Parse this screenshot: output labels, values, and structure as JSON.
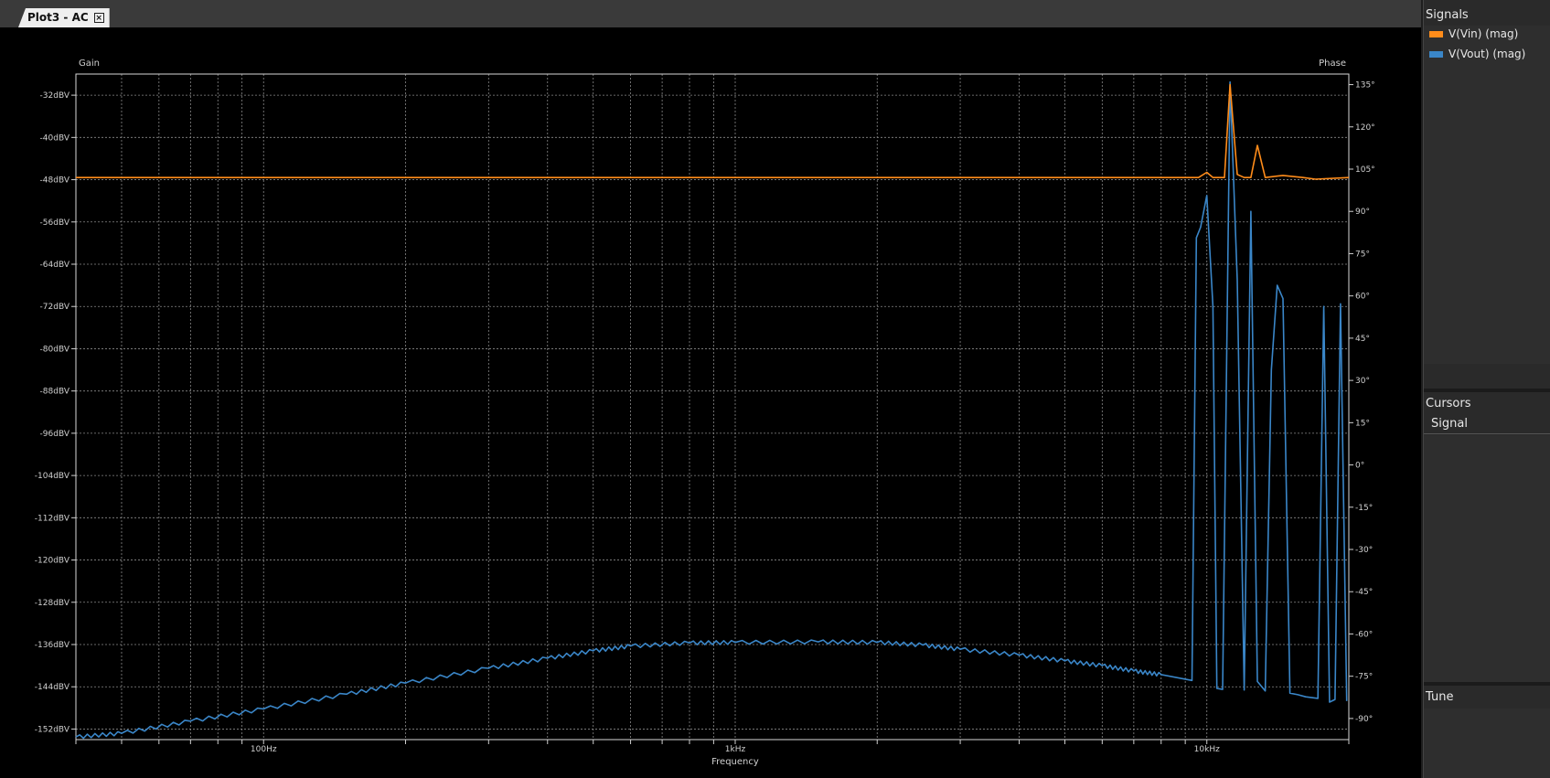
{
  "tab": {
    "label": "Plot3 - AC",
    "close_glyph": "×"
  },
  "panels": {
    "signals_title": "Signals",
    "cursors_title": "Cursors",
    "cursors_column": "Signal",
    "tune_title": "Tune"
  },
  "colors": {
    "vin": "#ff8c1a",
    "vout": "#3a86c8",
    "grid": "#8a8a8a",
    "bg": "#000000"
  },
  "chart_data": {
    "type": "line",
    "x_scale": "log",
    "xlim": [
      40,
      20000
    ],
    "ylim": [
      -154,
      -28
    ],
    "y2lim": [
      -97.5,
      138.75
    ],
    "title": "",
    "xlabel": "Frequency",
    "ylabel": "Gain",
    "y2label": "Phase",
    "x_ticks": [
      {
        "value": 100,
        "label": "100Hz"
      },
      {
        "value": 1000,
        "label": "1kHz"
      },
      {
        "value": 10000,
        "label": "10kHz"
      }
    ],
    "y_ticks": [
      {
        "value": -32,
        "label": "-32dBV"
      },
      {
        "value": -40,
        "label": "-40dBV"
      },
      {
        "value": -48,
        "label": "-48dBV"
      },
      {
        "value": -56,
        "label": "-56dBV"
      },
      {
        "value": -64,
        "label": "-64dBV"
      },
      {
        "value": -72,
        "label": "-72dBV"
      },
      {
        "value": -80,
        "label": "-80dBV"
      },
      {
        "value": -88,
        "label": "-88dBV"
      },
      {
        "value": -96,
        "label": "-96dBV"
      },
      {
        "value": -104,
        "label": "-104dBV"
      },
      {
        "value": -112,
        "label": "-112dBV"
      },
      {
        "value": -120,
        "label": "-120dBV"
      },
      {
        "value": -128,
        "label": "-128dBV"
      },
      {
        "value": -136,
        "label": "-136dBV"
      },
      {
        "value": -144,
        "label": "-144dBV"
      },
      {
        "value": -152,
        "label": "-152dBV"
      }
    ],
    "y2_ticks": [
      {
        "value": 135,
        "label": "135°"
      },
      {
        "value": 120,
        "label": "120°"
      },
      {
        "value": 105,
        "label": "105°"
      },
      {
        "value": 90,
        "label": "90°"
      },
      {
        "value": 75,
        "label": "75°"
      },
      {
        "value": 60,
        "label": "60°"
      },
      {
        "value": 45,
        "label": "45°"
      },
      {
        "value": 30,
        "label": "30°"
      },
      {
        "value": 15,
        "label": "15°"
      },
      {
        "value": 0,
        "label": "0°"
      },
      {
        "value": -15,
        "label": "-15°"
      },
      {
        "value": -30,
        "label": "-30°"
      },
      {
        "value": -45,
        "label": "-45°"
      },
      {
        "value": -60,
        "label": "-60°"
      },
      {
        "value": -75,
        "label": "-75°"
      },
      {
        "value": -90,
        "label": "-90°"
      }
    ],
    "grid": true,
    "series": [
      {
        "name": "V(Vin) (mag)",
        "color": "#ff8c1a",
        "points": [
          [
            40,
            -47.6
          ],
          [
            9000,
            -47.6
          ],
          [
            9600,
            -47.6
          ],
          [
            10000,
            -46.6
          ],
          [
            10300,
            -47.6
          ],
          [
            10900,
            -47.6
          ],
          [
            11200,
            -30
          ],
          [
            11600,
            -47
          ],
          [
            12000,
            -47.6
          ],
          [
            12400,
            -47.6
          ],
          [
            12800,
            -41.5
          ],
          [
            13300,
            -47.6
          ],
          [
            14500,
            -47.2
          ],
          [
            16000,
            -47.6
          ],
          [
            17000,
            -47.9
          ],
          [
            20000,
            -47.6
          ]
        ]
      },
      {
        "name": "V(Vout) (mag)",
        "color": "#3a86c8",
        "points": [
          [
            40,
            -153.5
          ],
          [
            50,
            -152.8
          ],
          [
            70,
            -150.5
          ],
          [
            100,
            -148.2
          ],
          [
            150,
            -145.4
          ],
          [
            200,
            -143.3
          ],
          [
            300,
            -140.5
          ],
          [
            400,
            -138.6
          ],
          [
            500,
            -137.2
          ],
          [
            600,
            -136.3
          ],
          [
            800,
            -135.7
          ],
          [
            1000,
            -135.6
          ],
          [
            1500,
            -135.5
          ],
          [
            2000,
            -135.6
          ],
          [
            2500,
            -136.1
          ],
          [
            3000,
            -136.9
          ],
          [
            4000,
            -138.0
          ],
          [
            5000,
            -139.1
          ],
          [
            6000,
            -140.0
          ],
          [
            7000,
            -141.0
          ],
          [
            8000,
            -141.7
          ],
          [
            9300,
            -142.8
          ],
          [
            9500,
            -59
          ],
          [
            9700,
            -57
          ],
          [
            10000,
            -51
          ],
          [
            10300,
            -72
          ],
          [
            10500,
            -144.3
          ],
          [
            10800,
            -144.5
          ],
          [
            11200,
            -29.5
          ],
          [
            11600,
            -67
          ],
          [
            12000,
            -144.6
          ],
          [
            12400,
            -54
          ],
          [
            12800,
            -143
          ],
          [
            13300,
            -144.8
          ],
          [
            13700,
            -84
          ],
          [
            14100,
            -68
          ],
          [
            14500,
            -70.5
          ],
          [
            15000,
            -145.2
          ],
          [
            15600,
            -145.5
          ],
          [
            16200,
            -145.9
          ],
          [
            17200,
            -146.2
          ],
          [
            17700,
            -72
          ],
          [
            18200,
            -146.9
          ],
          [
            18700,
            -146.4
          ],
          [
            19200,
            -71.5
          ],
          [
            19800,
            -146.7
          ]
        ]
      }
    ]
  }
}
